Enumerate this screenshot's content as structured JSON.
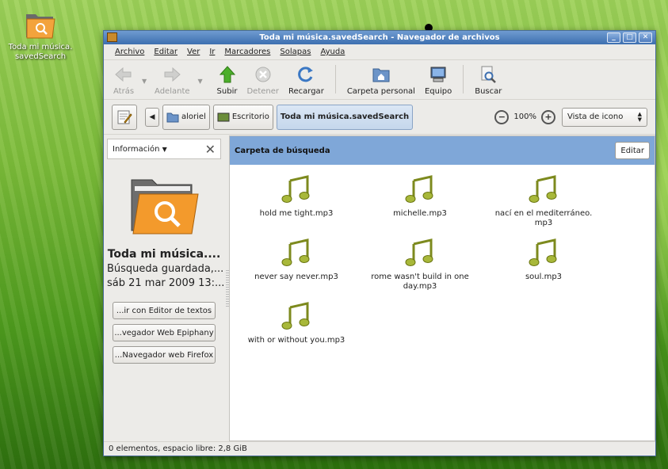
{
  "desktop": {
    "icon_label": "Toda mi música.\nsavedSearch"
  },
  "window": {
    "title": "Toda mi música.savedSearch - Navegador de archivos",
    "wm_buttons": [
      "_",
      "□",
      "✕"
    ]
  },
  "menubar": {
    "items": [
      "Archivo",
      "Editar",
      "Ver",
      "Ir",
      "Marcadores",
      "Solapas",
      "Ayuda"
    ]
  },
  "toolbar": {
    "back": "Atrás",
    "forward": "Adelante",
    "up": "Subir",
    "stop": "Detener",
    "reload": "Recargar",
    "home": "Carpeta personal",
    "computer": "Equipo",
    "search": "Buscar"
  },
  "location": {
    "crumbs": [
      "aloriel",
      "Escritorio",
      "Toda mi música.savedSearch"
    ],
    "zoom_level": "100%",
    "view_mode": "Vista de icono"
  },
  "sidepane": {
    "header": "Información",
    "title": "Toda mi música....",
    "subtitle": "Búsqueda guardada,...",
    "date": "sáb 21 mar 2009 13:...",
    "open_with": [
      "...ir con Editor de textos",
      "...vegador Web Epiphany",
      "...Navegador web Firefox"
    ]
  },
  "main": {
    "search_label": "Carpeta de búsqueda",
    "edit_button": "Editar",
    "files": [
      "hold me tight.mp3",
      "michelle.mp3",
      "nací en el mediterráneo.\nmp3",
      "never say never.mp3",
      "rome wasn't build in one day.mp3",
      "soul.mp3",
      "with or without you.mp3"
    ]
  },
  "statusbar": {
    "text": "0 elementos, espacio libre: 2,8 GiB"
  },
  "colors": {
    "accent": "#7fa7d8",
    "title": "#3d6fb0",
    "note": "#8a9a2a"
  }
}
